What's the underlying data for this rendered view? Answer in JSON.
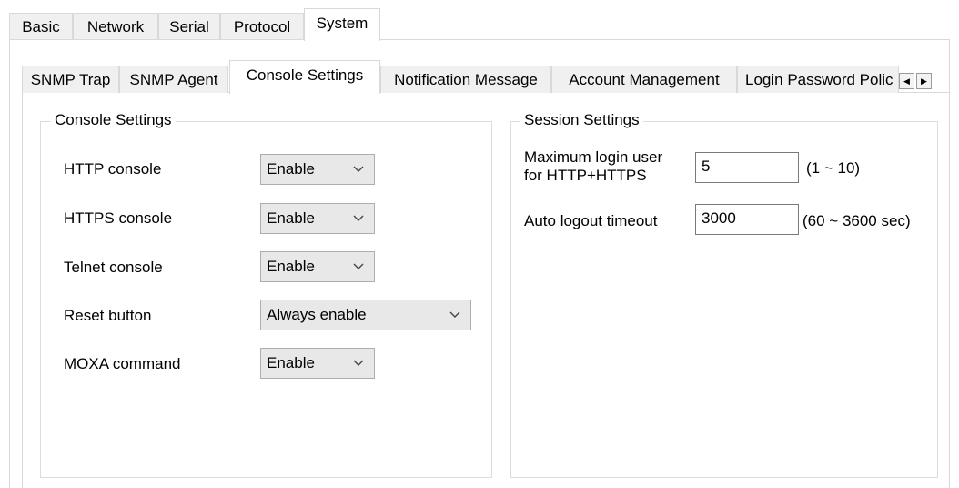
{
  "top_tabs": [
    "Basic",
    "Network",
    "Serial",
    "Protocol",
    "System"
  ],
  "sub_tabs": [
    "SNMP Trap",
    "SNMP Agent",
    "Console Settings",
    "Notification Message",
    "Account Management",
    "Login Password Polic"
  ],
  "scroll": {
    "left_glyph": "◀",
    "right_glyph": "▶"
  },
  "console_group": {
    "title": "Console Settings",
    "rows": [
      {
        "label": "HTTP console",
        "value": "Enable"
      },
      {
        "label": "HTTPS console",
        "value": "Enable"
      },
      {
        "label": "Telnet console",
        "value": "Enable"
      },
      {
        "label": "Reset button",
        "value": "Always enable"
      },
      {
        "label": "MOXA command",
        "value": "Enable"
      }
    ]
  },
  "session_group": {
    "title": "Session Settings",
    "max_login_label_line1": "Maximum login user",
    "max_login_label_line2": "for HTTP+HTTPS",
    "max_login_value": "5",
    "max_login_range": "(1 ~ 10)",
    "auto_logout_label": "Auto logout timeout",
    "auto_logout_value": "3000",
    "auto_logout_range": "(60 ~ 3600 sec)"
  }
}
